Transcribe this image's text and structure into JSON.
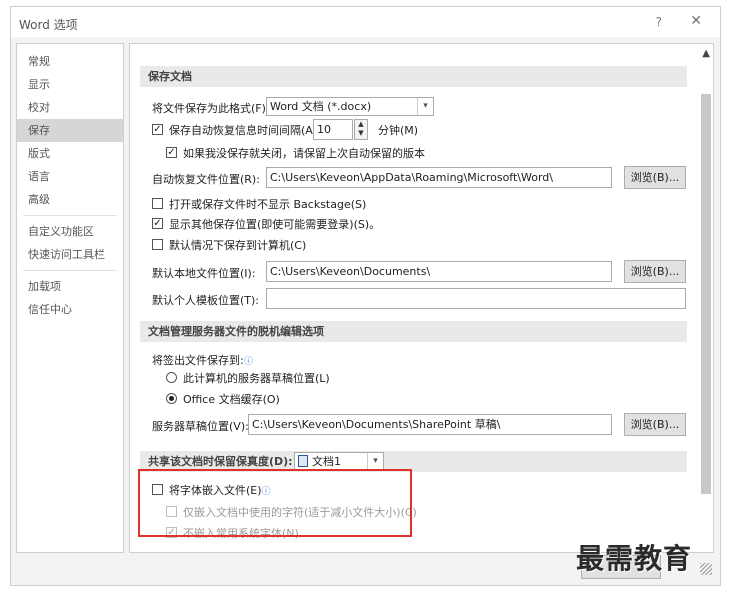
{
  "window": {
    "title": "Word 选项",
    "help": "?",
    "close": "✕"
  },
  "nav": {
    "items": [
      {
        "label": "常规"
      },
      {
        "label": "显示"
      },
      {
        "label": "校对"
      },
      {
        "label": "保存",
        "active": true
      },
      {
        "label": "版式"
      },
      {
        "label": "语言"
      },
      {
        "label": "高级"
      },
      {
        "label": "自定义功能区"
      },
      {
        "label": "快速访问工具栏"
      },
      {
        "label": "加载项"
      },
      {
        "label": "信任中心"
      }
    ]
  },
  "save": {
    "section_title": "保存文档",
    "format_label": "将文件保存为此格式(F):",
    "format_value": "Word 文档 (*.docx)",
    "autorecover_label": "保存自动恢复信息时间间隔(A)",
    "autorecover_value": "10",
    "minutes_label": "分钟(M)",
    "keep_last_label": "如果我没保存就关闭，请保留上次自动保留的版本",
    "autorecover_location_label": "自动恢复文件位置(R):",
    "autorecover_location_value": "C:\\Users\\Keveon\\AppData\\Roaming\\Microsoft\\Word\\",
    "browse_label": "浏览(B)...",
    "no_backstage_label": "打开或保存文件时不显示 Backstage(S)",
    "show_additional_label": "显示其他保存位置(即使可能需要登录)(S)。",
    "default_computer_label": "默认情况下保存到计算机(C)",
    "default_local_label": "默认本地文件位置(I):",
    "default_local_value": "C:\\Users\\Keveon\\Documents\\",
    "template_label": "默认个人模板位置(T):",
    "template_value": ""
  },
  "offline": {
    "section_title": "文档管理服务器文件的脱机编辑选项",
    "checkout_label": "将签出文件保存到:",
    "server_drafts_label": "此计算机的服务器草稿位置(L)",
    "office_cache_label": "Office 文档缓存(O)",
    "drafts_location_label": "服务器草稿位置(V):",
    "drafts_location_value": "C:\\Users\\Keveon\\Documents\\SharePoint 草稿\\"
  },
  "fidelity": {
    "section_title": "共享该文档时保留保真度(D):",
    "document_value": "文档1",
    "embed_fonts_label": "将字体嵌入文件(E)",
    "embed_used_label": "仅嵌入文档中使用的字符(适于减小文件大小)(C)",
    "no_common_label": "不嵌入常用系统字体(N)"
  },
  "watermark": {
    "text": "最需教育"
  }
}
